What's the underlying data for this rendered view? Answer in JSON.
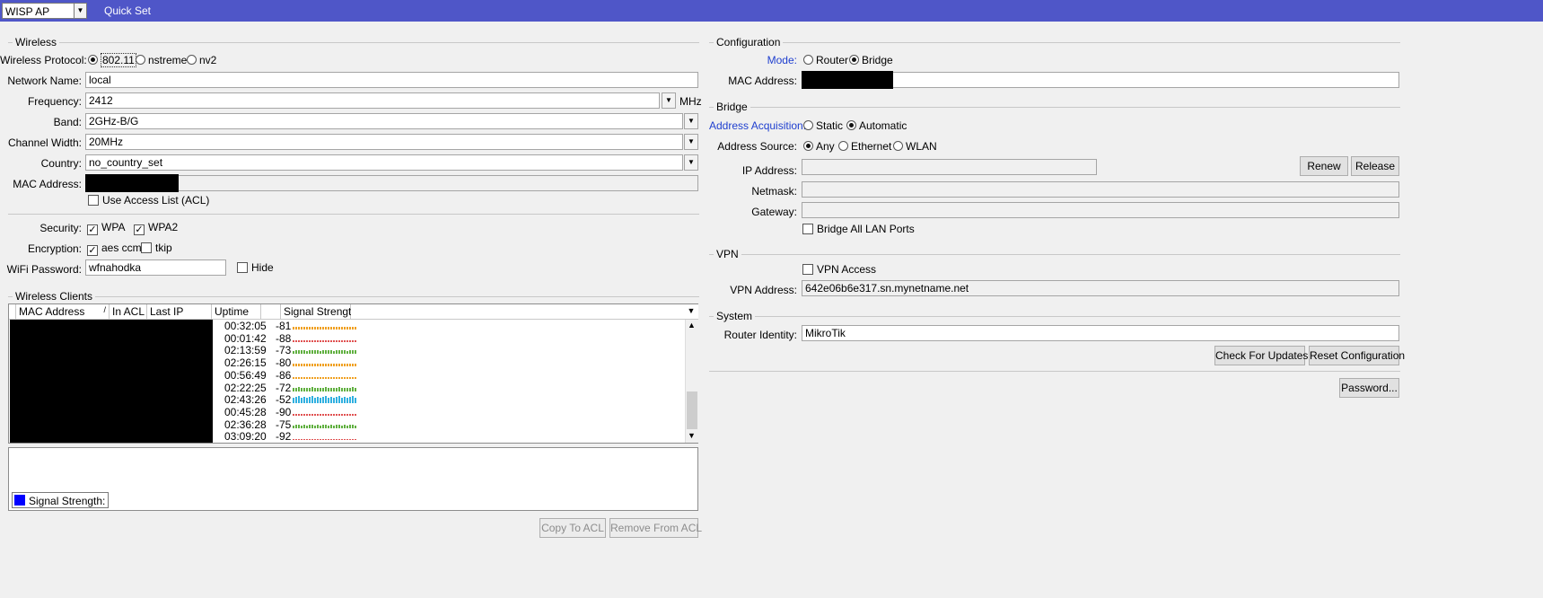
{
  "topbar": {
    "mode_value": "WISP AP",
    "title": "Quick Set"
  },
  "wireless": {
    "title": "Wireless",
    "protocol_label": "Wireless Protocol:",
    "protocol_options": [
      "802.11",
      "nstreme",
      "nv2"
    ],
    "network_name_label": "Network Name:",
    "network_name": "local",
    "frequency_label": "Frequency:",
    "frequency": "2412",
    "frequency_unit": "MHz",
    "band_label": "Band:",
    "band": "2GHz-B/G",
    "channel_width_label": "Channel Width:",
    "channel_width": "20MHz",
    "country_label": "Country:",
    "country": "no_country_set",
    "mac_label": "MAC Address:",
    "use_acl_label": "Use Access List (ACL)",
    "security_label": "Security:",
    "wpa_label": "WPA",
    "wpa2_label": "WPA2",
    "encryption_label": "Encryption:",
    "aes_label": "aes ccm",
    "tkip_label": "tkip",
    "password_label": "WiFi Password:",
    "password": "wfnahodka",
    "hide_label": "Hide"
  },
  "clients": {
    "title": "Wireless Clients",
    "columns": [
      "MAC Address",
      "In ACL",
      "Last IP",
      "Uptime",
      "",
      "Signal Strength"
    ],
    "rows": [
      {
        "uptime": "00:32:05",
        "signal": "-81",
        "color": "#f0a020"
      },
      {
        "uptime": "00:01:42",
        "signal": "-88",
        "color": "#e05050"
      },
      {
        "uptime": "02:13:59",
        "signal": "-73",
        "color": "#60b040"
      },
      {
        "uptime": "02:26:15",
        "signal": "-80",
        "color": "#f0a020"
      },
      {
        "uptime": "00:56:49",
        "signal": "-86",
        "color": "#f0a020"
      },
      {
        "uptime": "02:22:25",
        "signal": "-72",
        "color": "#60b040"
      },
      {
        "uptime": "02:43:26",
        "signal": "-52",
        "color": "#30b0e0"
      },
      {
        "uptime": "00:45:28",
        "signal": "-90",
        "color": "#e05050"
      },
      {
        "uptime": "02:36:28",
        "signal": "-75",
        "color": "#60b040"
      },
      {
        "uptime": "03:09:20",
        "signal": "-92",
        "color": "#e05050"
      }
    ],
    "legend_label": "Signal Strength:",
    "legend_color": "#0000ff",
    "copy_btn": "Copy To ACL",
    "remove_btn": "Remove From ACL"
  },
  "configuration": {
    "title": "Configuration",
    "mode_label": "Mode:",
    "router_label": "Router",
    "bridge_label": "Bridge",
    "mac_label": "MAC Address:"
  },
  "bridge": {
    "title": "Bridge",
    "acq_label": "Address Acquisition:",
    "static_label": "Static",
    "automatic_label": "Automatic",
    "source_label": "Address Source:",
    "any_label": "Any",
    "ethernet_label": "Ethernet",
    "wlan_label": "WLAN",
    "ip_label": "IP Address:",
    "renew_btn": "Renew",
    "release_btn": "Release",
    "netmask_label": "Netmask:",
    "gateway_label": "Gateway:",
    "bridge_all_label": "Bridge All LAN Ports"
  },
  "vpn": {
    "title": "VPN",
    "access_label": "VPN Access",
    "address_label": "VPN Address:",
    "address": "642e06b6e317.sn.mynetname.net"
  },
  "system": {
    "title": "System",
    "identity_label": "Router Identity:",
    "identity": "MikroTik",
    "check_btn": "Check For Updates",
    "reset_btn": "Reset Configuration",
    "password_btn": "Password..."
  }
}
